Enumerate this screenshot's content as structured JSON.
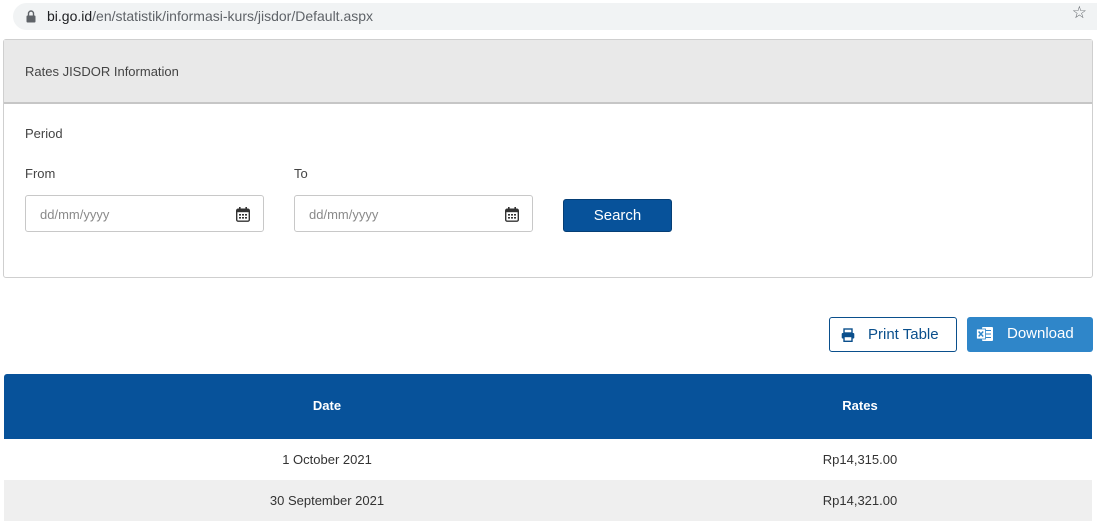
{
  "browser": {
    "url_host": "bi.go.id",
    "url_path": "/en/statistik/informasi-kurs/jisdor/Default.aspx"
  },
  "panel": {
    "title": "Rates JISDOR Information",
    "period_label": "Period",
    "from_label": "From",
    "to_label": "To",
    "from_placeholder": "dd/mm/yyyy",
    "to_placeholder": "dd/mm/yyyy",
    "search_label": "Search"
  },
  "actions": {
    "print_label": "Print Table",
    "download_label": "Download"
  },
  "table": {
    "columns": [
      "Date",
      "Rates"
    ],
    "rows": [
      {
        "date": "1 October 2021",
        "rate": "Rp14,315.00"
      },
      {
        "date": "30 September 2021",
        "rate": "Rp14,321.00"
      }
    ]
  },
  "colors": {
    "primary": "#07529a",
    "download": "#2f86c9",
    "panel_header": "#e9e9e9",
    "row_alt": "#efefef"
  },
  "icons": [
    "lock-icon",
    "star-icon",
    "calendar-icon",
    "printer-icon",
    "excel-icon"
  ]
}
